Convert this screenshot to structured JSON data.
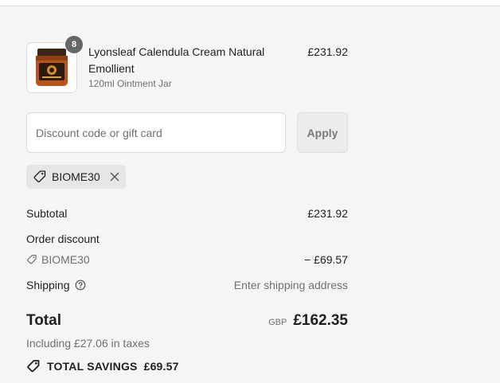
{
  "product": {
    "quantity": "8",
    "title": "Lyonsleaf Calendula Cream Natural Emollient",
    "variant": "120ml Ointment Jar",
    "price": "£231.92",
    "image_icon": "ointment-jar-icon"
  },
  "discount": {
    "placeholder": "Discount code or gift card",
    "value": "",
    "apply_label": "Apply",
    "applied_code": "BIOME30"
  },
  "summary": {
    "subtotal_label": "Subtotal",
    "subtotal_value": "£231.92",
    "order_discount_label": "Order discount",
    "discount_code": "BIOME30",
    "discount_value": "− £69.57",
    "shipping_label": "Shipping",
    "shipping_value": "Enter shipping address",
    "total_label": "Total",
    "currency": "GBP",
    "total_value": "£162.35",
    "taxes_text": "Including £27.06 in taxes",
    "savings_label": "TOTAL SAVINGS",
    "savings_value": "£69.57"
  },
  "colors": {
    "background": "#f5f5f5",
    "text": "#1f1f1f",
    "muted": "#707070",
    "badge": "#666666",
    "chip": "#e6e6e6"
  }
}
